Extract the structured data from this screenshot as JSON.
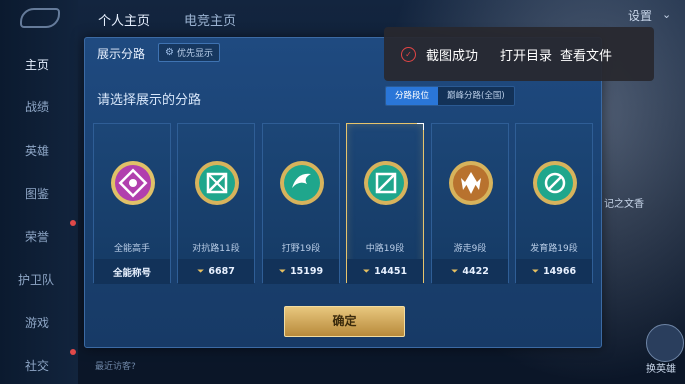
{
  "sidebar": {
    "items": [
      {
        "label": "主页",
        "active": true
      },
      {
        "label": "战绩"
      },
      {
        "label": "英雄"
      },
      {
        "label": "图鉴"
      },
      {
        "label": "荣誉"
      },
      {
        "label": "护卫队"
      },
      {
        "label": "游戏"
      },
      {
        "label": "社交"
      }
    ]
  },
  "top_nav": [
    {
      "label": "个人主页",
      "active": true
    },
    {
      "label": "电竞主页"
    }
  ],
  "settings_label": "设置",
  "right_labels": {
    "wenzhi": "记之文香",
    "change_hero": "换英雄"
  },
  "bottom_hint": "最近访客?",
  "dialog": {
    "title": "展示分路",
    "priority_label": "优先显示",
    "subtitle": "请选择展示的分路",
    "tabs": [
      {
        "label": "分路段位",
        "active": true
      },
      {
        "label": "巅峰分路(全国)",
        "active": false
      }
    ],
    "cards": [
      {
        "name": "全能高手",
        "value": "全能称号",
        "icon": "allround-badge-icon",
        "color": "#b13fae",
        "show_chevron": false
      },
      {
        "name": "对抗路11段",
        "value": "6687",
        "icon": "clash-lane-badge-icon",
        "color": "#1fa68c",
        "show_chevron": true
      },
      {
        "name": "打野19段",
        "value": "15199",
        "icon": "jungle-badge-icon",
        "color": "#1fa68c",
        "show_chevron": true
      },
      {
        "name": "中路19段",
        "value": "14451",
        "icon": "mid-lane-badge-icon",
        "color": "#1fa68c",
        "show_chevron": true,
        "selected": true
      },
      {
        "name": "游走9段",
        "value": "4422",
        "icon": "roam-badge-icon",
        "color": "#b8722e",
        "show_chevron": true
      },
      {
        "name": "发育路19段",
        "value": "14966",
        "icon": "farm-lane-badge-icon",
        "color": "#1fa68c",
        "show_chevron": true
      }
    ],
    "confirm_label": "确定"
  },
  "toast": {
    "message": "截图成功",
    "open_dir": "打开目录",
    "view_file": "查看文件"
  }
}
